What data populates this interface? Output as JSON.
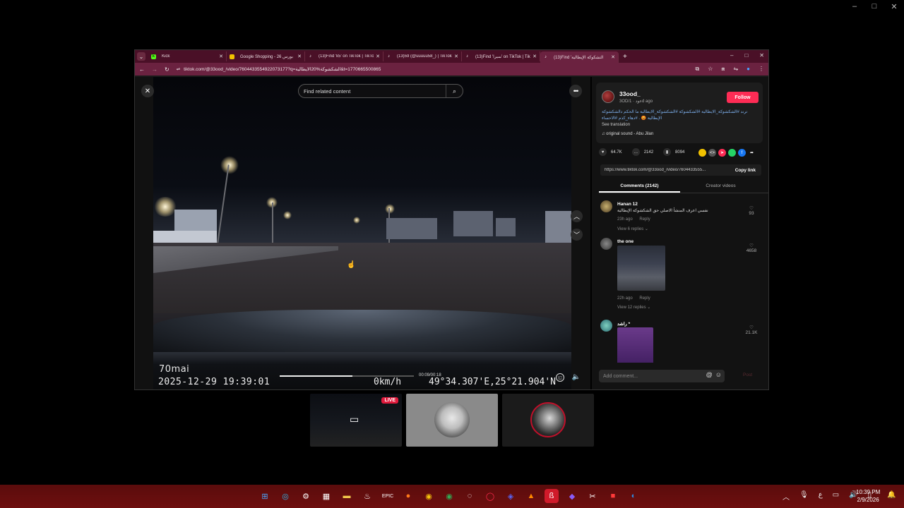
{
  "outer_window": {
    "controls": [
      "–",
      "□",
      "✕"
    ]
  },
  "browser": {
    "tabs": [
      {
        "title": "Kick",
        "icon": "kick-icon",
        "color": "#53fc18",
        "active": false
      },
      {
        "title": "Google Shopping - 26 بورس",
        "icon": "shopping-icon",
        "color": "#f2c200",
        "active": false
      },
      {
        "title": "(13)Find 'k5' on TikTok | TikTok",
        "icon": "tiktok-icon",
        "color": "#ffffff",
        "active": false
      },
      {
        "title": "(13)59 (@uuuuu58_) | TikTok",
        "icon": "tiktok-icon",
        "color": "#ffffff",
        "active": false
      },
      {
        "title": "(13)Find 'سيرا' on TikTok | TikTok",
        "icon": "tiktok-icon",
        "color": "#ffffff",
        "active": false
      },
      {
        "title": "(13)Find 'التشكوكة الإيطالية",
        "icon": "tiktok-icon",
        "color": "#ffffff",
        "active": true
      }
    ],
    "window_controls": [
      "–",
      "□",
      "✕"
    ],
    "url": "tiktok.com/@33ood_/video/7604433554922073177?q=الشكشوكة%20الايطالية&t=1770665500865"
  },
  "video": {
    "search_placeholder": "Find related content",
    "brand": "70mai",
    "timestamp": "2025-12-29  19:39:01",
    "speed": "0km/h",
    "gps": "49°34.307'E,25°21.904'N",
    "time_label": "00:09/00:18",
    "progress": 0.54
  },
  "side": {
    "author": {
      "name": "33ood_",
      "sub": "3OD/عود · 1d ago",
      "follow_label": "Follow"
    },
    "caption": "ترند #الشكشوكة_الايطالية #الشكشوكة #الشكشوكة_الايطالية ما الحكم دالشكشوكة الإيطالية 😡 . #دهاء_كذم #الاحساء",
    "see_translation": "See translation",
    "sound": "♫ original sound - Abu Jilan",
    "stats": {
      "likes": "64.7K",
      "comments": "2142",
      "saves": "8094"
    },
    "share_colors": [
      "#f2c200",
      "#555555",
      "#fe2c55",
      "#25d366",
      "#1877f2"
    ],
    "link": "https://www.tiktok.com/@33ood_/video/7604433555...",
    "copy_label": "Copy link",
    "tabs": [
      "Comments (2142)",
      "Creator videos"
    ],
    "comments": [
      {
        "name": "Hanan 12",
        "text": "نفسي اعرف المنشأ الاصلي حق الشكشوكة الإيطالية",
        "time": "23h ago",
        "reply": "Reply",
        "replies": "View 6 replies ⌄",
        "likes": "93"
      },
      {
        "name": "the one",
        "text": "",
        "time": "22h ago",
        "reply": "Reply",
        "replies": "View 12 replies ⌄",
        "likes": "4658"
      },
      {
        "name": "راشد *",
        "text": "",
        "time": "",
        "reply": "",
        "replies": "",
        "likes": "21.1K"
      }
    ],
    "comment_placeholder": "Add comment...",
    "post_label": "Post"
  },
  "thumbs": {
    "live_label": "LIVE"
  },
  "taskbar": {
    "time": "10:39 PM",
    "date": "2/9/2026",
    "lang": "ع"
  }
}
